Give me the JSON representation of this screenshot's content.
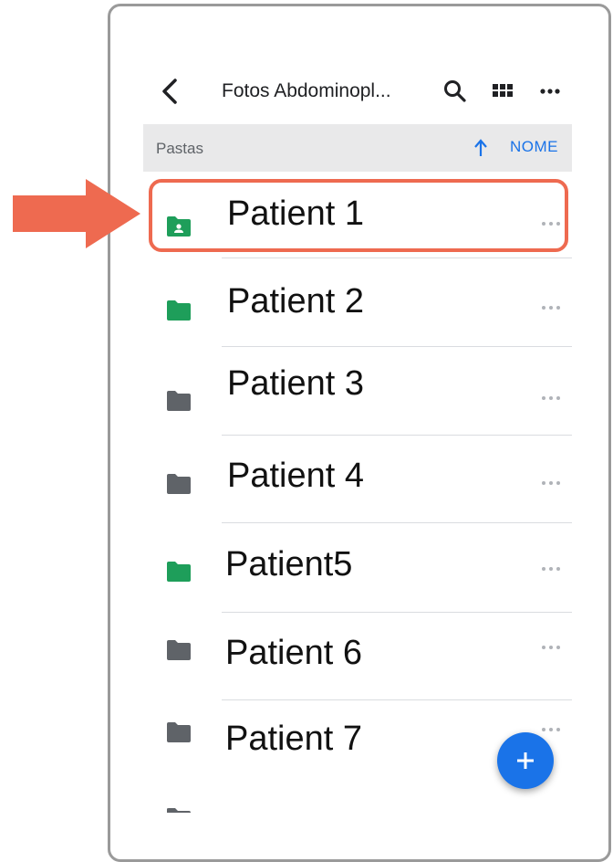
{
  "header": {
    "title": "Fotos Abdominopl...",
    "icons": [
      "back-arrow-icon",
      "search-icon",
      "grid-view-icon",
      "more-options-icon"
    ]
  },
  "section": {
    "label": "Pastas",
    "sort_label": "NOME",
    "sort_direction_icon": "arrow-up-icon"
  },
  "folders": [
    {
      "name": "Patient 1",
      "icon": "shared-folder-icon",
      "color": "#1e9e5a",
      "highlighted": true
    },
    {
      "name": "Patient 2",
      "icon": "folder-icon",
      "color": "#1e9e5a"
    },
    {
      "name": "Patient 3",
      "icon": "folder-icon",
      "color": "#5f6368"
    },
    {
      "name": "Patient 4",
      "icon": "folder-icon",
      "color": "#5f6368"
    },
    {
      "name": "Patient5",
      "icon": "folder-icon",
      "color": "#1e9e5a"
    },
    {
      "name": "Patient 6",
      "icon": "folder-icon",
      "color": "#5f6368"
    },
    {
      "name": "Patient 7",
      "icon": "folder-icon",
      "color": "#5f6368"
    }
  ],
  "fab": {
    "icon": "plus-icon"
  },
  "colors": {
    "accent": "#1a73e8",
    "highlight": "#ee6a50",
    "folder_green": "#1e9e5a",
    "folder_gray": "#5f6368"
  }
}
